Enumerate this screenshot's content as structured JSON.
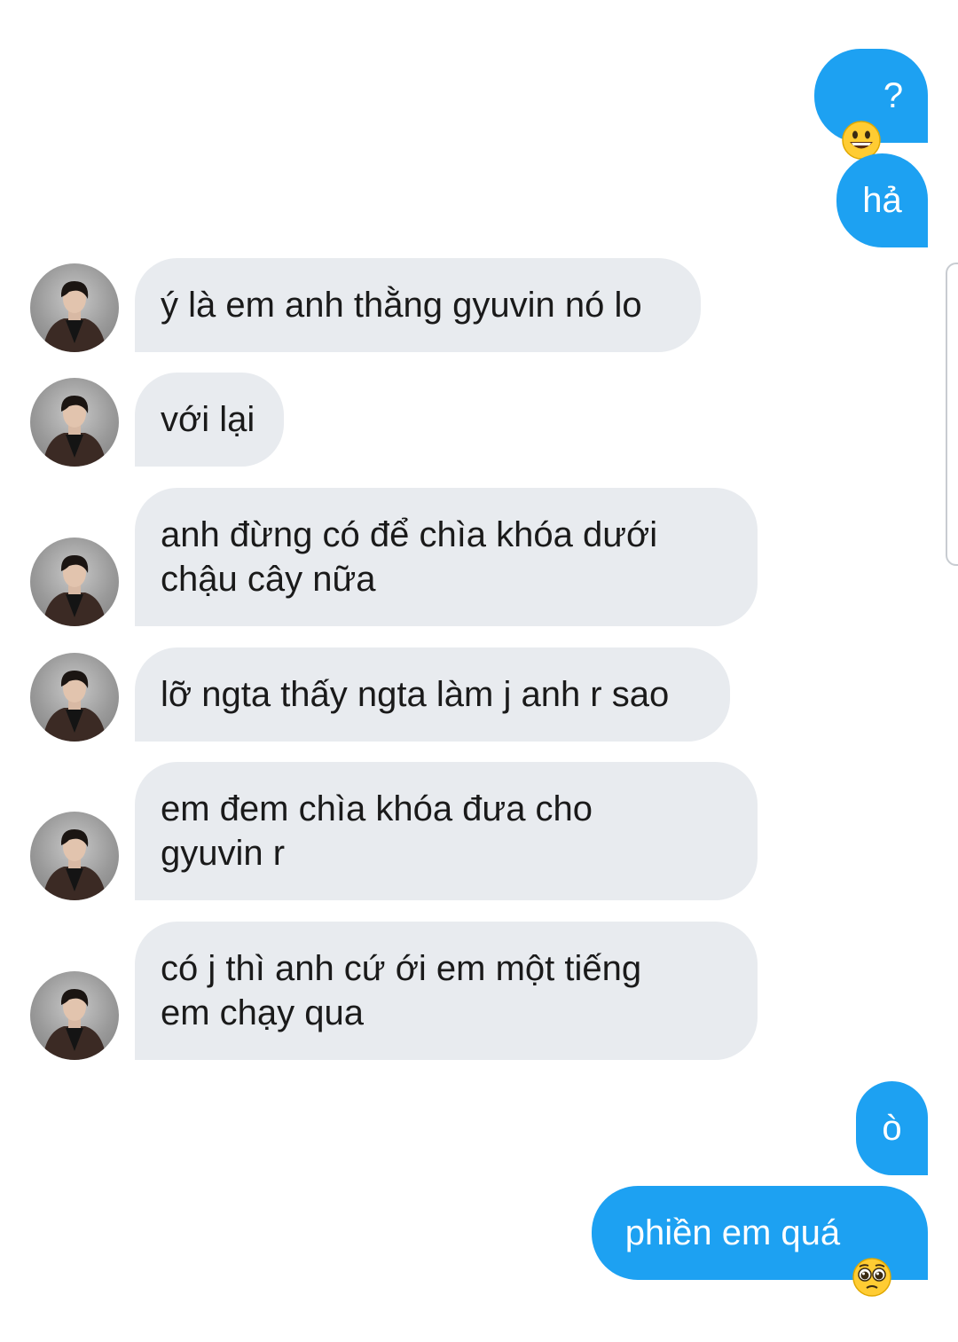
{
  "conversation": {
    "messages": [
      {
        "id": "m1",
        "side": "out",
        "text": "",
        "emoji_after": "grinning-face-emoji",
        "text_after": "?"
      },
      {
        "id": "m2",
        "side": "out",
        "text": "hả"
      },
      {
        "id": "m3",
        "side": "in",
        "text": "ý là em anh thằng gyuvin nó lo"
      },
      {
        "id": "m4",
        "side": "in",
        "text": "với lại"
      },
      {
        "id": "m5",
        "side": "in",
        "text": "anh đừng có để chìa khóa dưới\nchậu cây nữa"
      },
      {
        "id": "m6",
        "side": "in",
        "text": "lỡ ngta thấy ngta làm j anh r sao"
      },
      {
        "id": "m7",
        "side": "in",
        "text": "em đem chìa khóa đưa cho\ngyuvin r"
      },
      {
        "id": "m8",
        "side": "in",
        "text": "có j thì anh cứ ới em một tiếng\nem chạy qua"
      },
      {
        "id": "m9",
        "side": "out",
        "text": "ò"
      },
      {
        "id": "m10",
        "side": "out",
        "text": "phiền em quá ",
        "emoji_after": "pleading-face-emoji"
      }
    ]
  },
  "colors": {
    "outgoing_bubble": "#1da1f2",
    "incoming_bubble": "#e8ebef",
    "incoming_text": "#1a1a1a",
    "outgoing_text": "#ffffff"
  },
  "icons": {
    "avatar": "contact-avatar-photo",
    "emoji_1": "grinning-face-emoji",
    "emoji_2": "pleading-face-emoji"
  }
}
